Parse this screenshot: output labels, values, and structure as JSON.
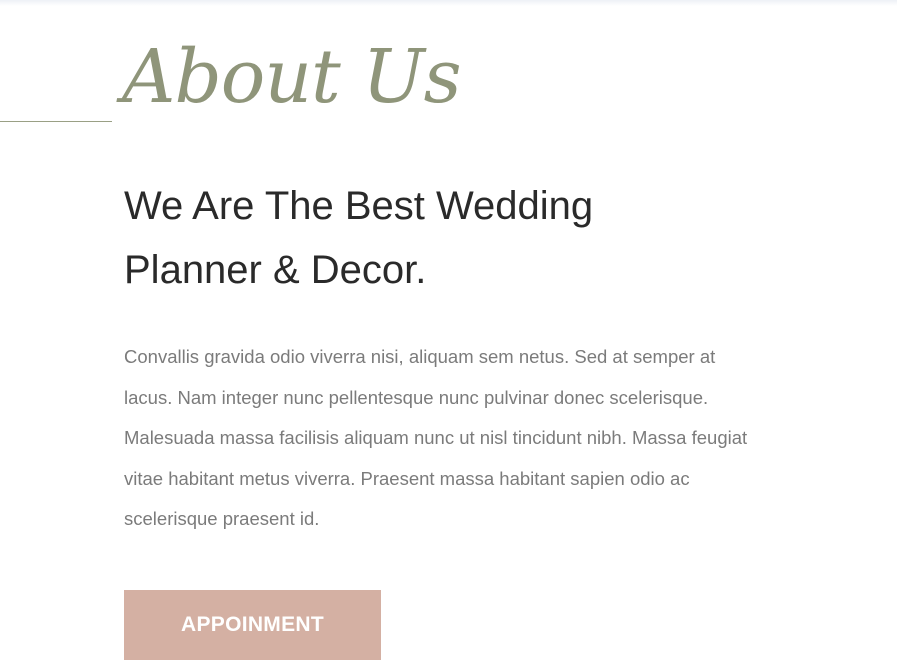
{
  "section": {
    "script_title": "About Us",
    "headline_line1": "We Are The Best Wedding",
    "headline_line2": "Planner & Decor.",
    "body": "Convallis gravida odio viverra nisi, aliquam sem netus. Sed at semper at lacus. Nam integer nunc pellentesque nunc pulvinar donec scelerisque. Malesuada massa facilisis aliquam nunc ut nisl tincidunt nibh. Massa feugiat vitae habitant metus viverra. Praesent massa habitant sapien odio ac scelerisque praesent id.",
    "button_label": "APPOINMENT"
  },
  "colors": {
    "accent_green": "#8f957a",
    "button_pink": "#d4b0a3",
    "heading": "#2a2a2a",
    "body_text": "#7b7b7b"
  }
}
